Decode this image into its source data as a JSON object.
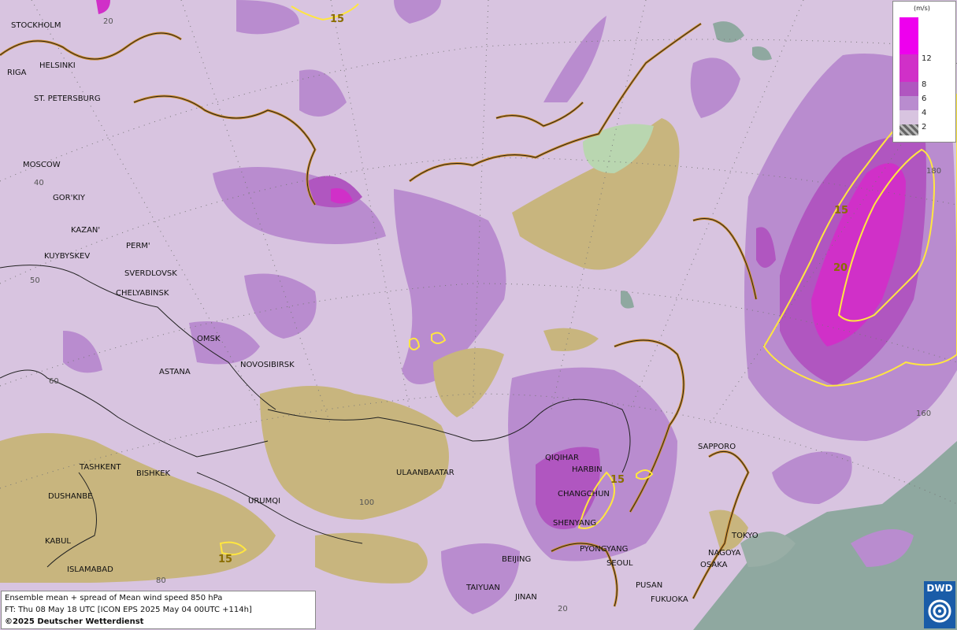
{
  "map": {
    "title": "Ensemble mean + spread of Mean wind speed 850 hPa",
    "forecast_time": "FT: Thu 08 May 18 UTC [ICON EPS 2025 May 04 00UTC +114h]",
    "copyright": "©2025 Deutscher Wetterdienst",
    "logo_text": "DWD",
    "colors": {
      "background": "#d8c4e0",
      "level_4": "#b98ccf",
      "level_6": "#b056c0",
      "level_8": "#d030c8",
      "level_12": "#ee00ee",
      "terrain": "#c8b57e",
      "sea_low_spread": "#8fa8a0",
      "contour": "#ffe640",
      "coast": "#d08b24"
    },
    "cities": [
      "STOCKHOLM",
      "HELSINKI",
      "RIGA",
      "ST. PETERSBURG",
      "MOSCOW",
      "GOR'KIY",
      "KAZAN'",
      "PERM'",
      "KUYBYSKEV",
      "SVERDLOVSK",
      "CHELYABINSK",
      "OMSK",
      "NOVOSIBIRSK",
      "ASTANA",
      "TASHKENT",
      "BISHKEK",
      "DUSHANBE",
      "URUMQI",
      "KABUL",
      "ISLAMABAD",
      "ULAANBAATAR",
      "QIQIHAR",
      "HARBIN",
      "CHANGCHUN",
      "SHENYANG",
      "PYONGYANG",
      "SEOUL",
      "BEIJING",
      "TAIYUAN",
      "JINAN",
      "PUSAN",
      "FUKUOKA",
      "SAPPORO",
      "TOKYO",
      "NAGOYA",
      "OSAKA"
    ],
    "grid_labels": [
      "20",
      "40",
      "50",
      "60",
      "100",
      "80",
      "20",
      "160",
      "180"
    ],
    "contour_labels": [
      "15",
      "15",
      "20",
      "15",
      "15"
    ]
  },
  "legend": {
    "unit": "(m/s)",
    "levels": [
      "12",
      "8",
      "6",
      "4",
      "2"
    ]
  }
}
